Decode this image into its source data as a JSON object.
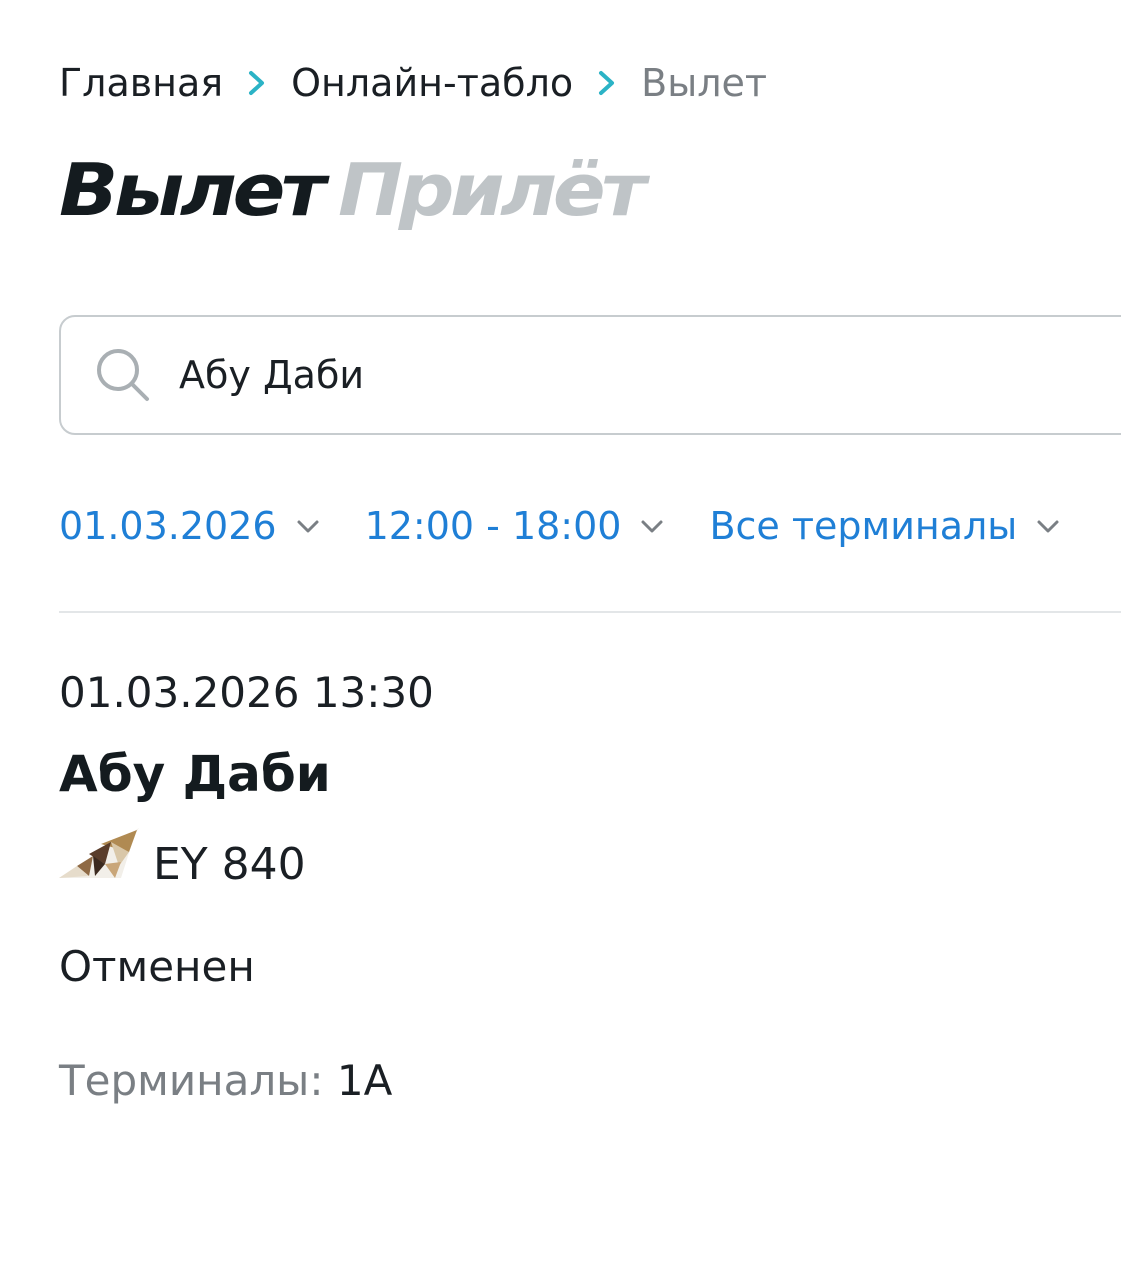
{
  "breadcrumb": {
    "items": [
      "Главная",
      "Онлайн-табло",
      "Вылет"
    ],
    "separator_icon": "chevron-right-icon",
    "separator_color": "#2bb3c6"
  },
  "tabs": {
    "active": "Вылет",
    "inactive": "Прилёт"
  },
  "search": {
    "icon": "search-icon",
    "value": "Абу Даби",
    "placeholder": ""
  },
  "filters": {
    "date": "01.03.2026",
    "time_range": "12:00 - 18:00",
    "terminals": "Все терминалы",
    "dropdown_icon": "chevron-down-icon",
    "accent_color": "#1f7fd6"
  },
  "flight": {
    "datetime": "01.03.2026 13:30",
    "destination": "Абу Даби",
    "airline_logo": "etihad-tail-logo",
    "number": "EY 840",
    "status": "Отменен",
    "terminals_label": "Терминалы:",
    "terminals_value": "1A"
  }
}
